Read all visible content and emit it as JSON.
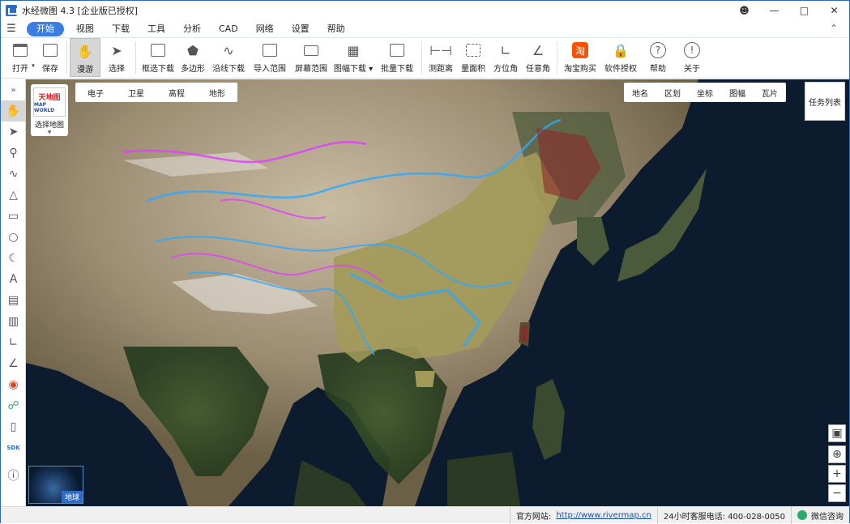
{
  "window": {
    "title": "水经微图 4.3 [企业版已授权]"
  },
  "menu": {
    "items": [
      "开始",
      "视图",
      "下载",
      "工具",
      "分析",
      "CAD",
      "网络",
      "设置",
      "帮助"
    ]
  },
  "toolbar": {
    "open": "打开",
    "save": "保存",
    "pan": "漫游",
    "select": "选择",
    "box_download": "框选下载",
    "polygon": "多边形",
    "line_download": "沿线下载",
    "import_range": "导入范围",
    "screen_range": "屏幕范围",
    "sheet_download": "图幅下载",
    "batch_download": "批量下载",
    "measure_distance": "测距离",
    "measure_area": "量面积",
    "azimuth": "方位角",
    "any_angle": "任意角",
    "taobao": "淘宝购买",
    "license": "软件授权",
    "help": "帮助",
    "about": "关于",
    "taobao_glyph": "淘"
  },
  "map_selector": {
    "logo_text": "天地图",
    "logo_sub": "MAP WORLD",
    "label": "选择地图"
  },
  "layer_tabs": [
    "电子",
    "卫星",
    "高程",
    "地形"
  ],
  "overlay_tabs": [
    "地名",
    "区划",
    "坐标",
    "图幅",
    "瓦片"
  ],
  "task_list": "任务列表",
  "earth_button": "地球",
  "sidebar": {
    "sdk": "SDK"
  },
  "status": {
    "site_label": "官方网站:",
    "site_url": "http://www.rivermap.cn",
    "hotline": "24小时客服电话: 400-028-0050",
    "wechat": "微信咨询"
  },
  "colors": {
    "accent": "#3b7de0",
    "water": "#0c1b2e",
    "route_cyan": "#2fa8ff",
    "route_magenta": "#e040fb",
    "route_olive": "#a39a5a"
  }
}
